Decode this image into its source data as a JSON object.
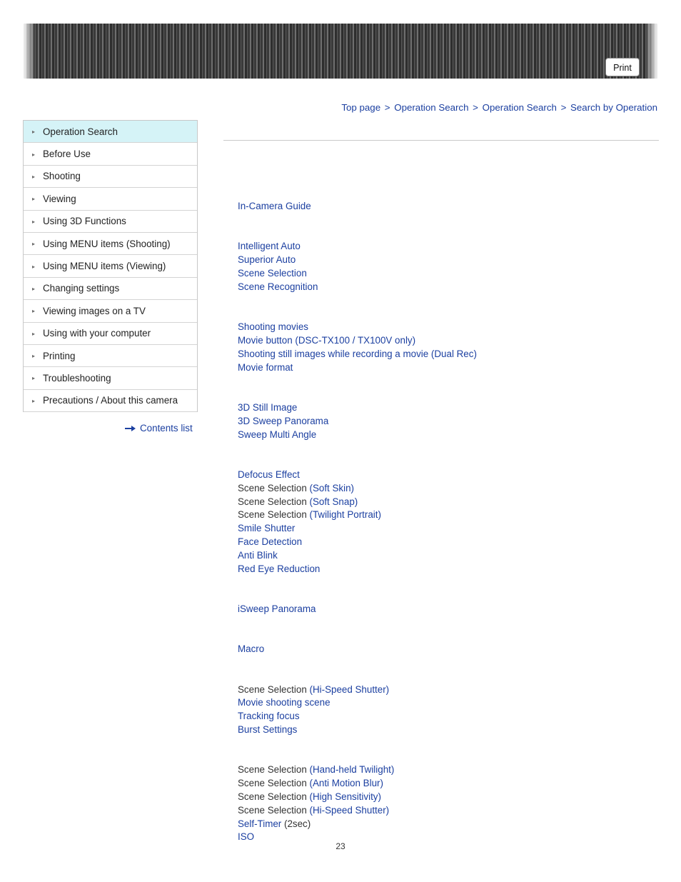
{
  "toolbar": {
    "print_label": "Print"
  },
  "breadcrumb": {
    "items": [
      "Top page",
      "Operation Search",
      "Operation Search",
      "Search by Operation"
    ],
    "separator": ">"
  },
  "sidebar": {
    "items": [
      {
        "label": "Operation Search",
        "active": true
      },
      {
        "label": "Before Use",
        "active": false
      },
      {
        "label": "Shooting",
        "active": false
      },
      {
        "label": "Viewing",
        "active": false
      },
      {
        "label": "Using 3D Functions",
        "active": false
      },
      {
        "label": "Using MENU items (Shooting)",
        "active": false
      },
      {
        "label": "Using MENU items (Viewing)",
        "active": false
      },
      {
        "label": "Changing settings",
        "active": false
      },
      {
        "label": "Viewing images on a TV",
        "active": false
      },
      {
        "label": "Using with your computer",
        "active": false
      },
      {
        "label": "Printing",
        "active": false
      },
      {
        "label": "Troubleshooting",
        "active": false
      },
      {
        "label": "Precautions / About this camera",
        "active": false
      }
    ],
    "contents_list_label": "Contents list"
  },
  "content": {
    "groups": [
      {
        "entries": [
          {
            "text": "In-Camera Guide",
            "link": true
          }
        ]
      },
      {
        "entries": [
          {
            "text": "Intelligent Auto",
            "link": true
          },
          {
            "text": "Superior Auto",
            "link": true
          },
          {
            "text": "Scene Selection",
            "link": true
          },
          {
            "text": "Scene Recognition",
            "link": true
          }
        ]
      },
      {
        "entries": [
          {
            "text": "Shooting movies",
            "link": true
          },
          {
            "text": "Movie button (DSC-TX100 / TX100V only)",
            "link": true
          },
          {
            "text": "Shooting still images while recording a movie (Dual Rec)",
            "link": true
          },
          {
            "text": "Movie format",
            "link": true
          }
        ]
      },
      {
        "entries": [
          {
            "text": "3D Still Image",
            "link": true
          },
          {
            "text": "3D Sweep Panorama",
            "link": true
          },
          {
            "text": "Sweep Multi Angle",
            "link": true
          }
        ]
      },
      {
        "entries": [
          {
            "text": "Defocus Effect",
            "link": true
          },
          {
            "prefix": "Scene Selection ",
            "suffix": "(Soft Skin)",
            "link": false
          },
          {
            "prefix": "Scene Selection ",
            "suffix": "(Soft Snap)",
            "link": false
          },
          {
            "prefix": "Scene Selection ",
            "suffix": "(Twilight Portrait)",
            "link": false
          },
          {
            "text": "Smile Shutter",
            "link": true
          },
          {
            "text": "Face Detection",
            "link": true
          },
          {
            "text": "Anti Blink",
            "link": true
          },
          {
            "text": "Red Eye Reduction",
            "link": true
          }
        ]
      },
      {
        "entries": [
          {
            "text": "iSweep Panorama",
            "link": true
          }
        ]
      },
      {
        "entries": [
          {
            "text": "Macro",
            "link": true
          }
        ]
      },
      {
        "entries": [
          {
            "prefix": "Scene Selection ",
            "suffix": "(Hi-Speed Shutter)",
            "link": false
          },
          {
            "text": "Movie shooting scene",
            "link": true
          },
          {
            "text": "Tracking focus",
            "link": true
          },
          {
            "text": "Burst Settings",
            "link": true
          }
        ]
      },
      {
        "entries": [
          {
            "prefix": "Scene Selection ",
            "suffix": "(Hand-held Twilight)",
            "link": false
          },
          {
            "prefix": "Scene Selection ",
            "suffix": "(Anti Motion Blur)",
            "link": false
          },
          {
            "prefix": "Scene Selection ",
            "suffix": "(High Sensitivity)",
            "link": false
          },
          {
            "prefix": "Scene Selection ",
            "suffix": "(Hi-Speed Shutter)",
            "link": false
          },
          {
            "prefix": "Self-Timer ",
            "suffix": "(2sec)",
            "link": true,
            "suffix_dark": true
          },
          {
            "text": "ISO",
            "link": true
          }
        ]
      }
    ]
  },
  "footer": {
    "page_number": "23"
  }
}
